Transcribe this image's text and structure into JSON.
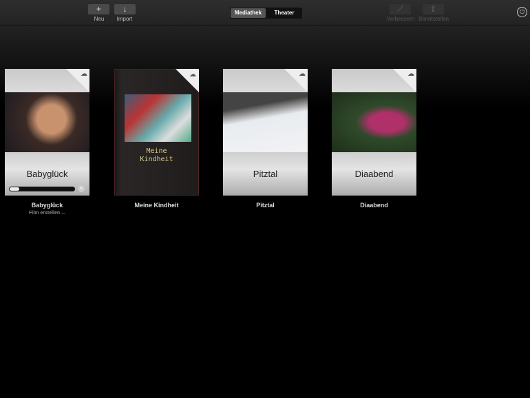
{
  "toolbar": {
    "new_label": "Neu",
    "import_label": "Import",
    "segments": [
      "Mediathek",
      "Theater"
    ],
    "enhance_label": "Verbessern",
    "share_label": "Bereitstellen"
  },
  "projects": [
    {
      "title": "Babyglück",
      "label": "Babyglück",
      "status": "Film erstellen ...",
      "progress": 0.15
    },
    {
      "title_line1": "Meine",
      "title_line2": "Kindheit",
      "label": "Meine Kindheit"
    },
    {
      "title": "Pitztal",
      "label": "Pitztal"
    },
    {
      "title": "Diaabend",
      "label": "Diaabend"
    }
  ]
}
